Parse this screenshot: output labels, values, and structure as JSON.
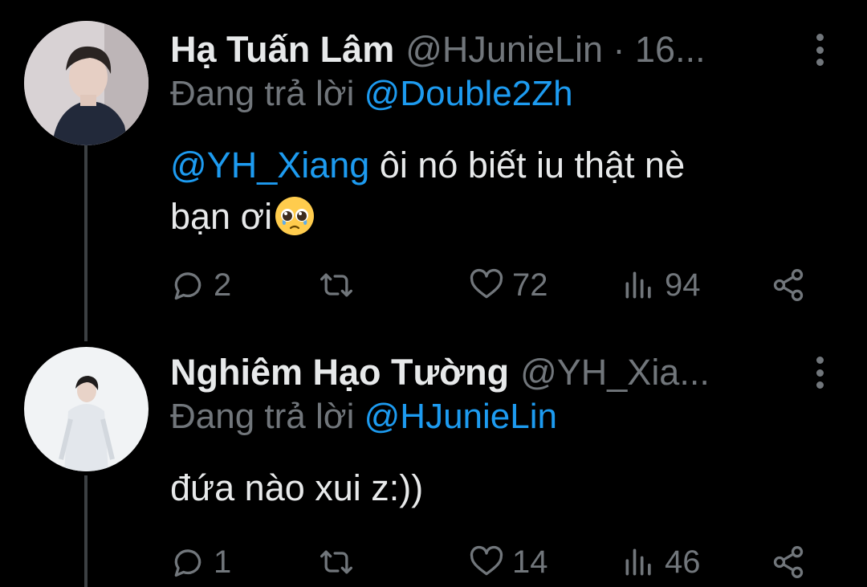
{
  "tweets": [
    {
      "name": "Hạ Tuấn Lâm",
      "handle": "@HJunieLin · 16...",
      "replying_prefix": "Đang trả lời",
      "replying_to": "@Double2Zh",
      "mention": "@YH_Xiang",
      "text_line1": " ôi nó biết iu thật nè",
      "text_line2": "bạn ơi",
      "emoji": "pleading-face",
      "replies": "2",
      "retweets": "",
      "likes": "72",
      "views": "94"
    },
    {
      "name": "Nghiêm Hạo Tường",
      "handle": "@YH_Xia...",
      "replying_prefix": "Đang trả lời",
      "replying_to": "@HJunieLin",
      "text": "đứa nào xui z:))",
      "replies": "1",
      "retweets": "",
      "likes": "14",
      "views": "46"
    }
  ],
  "colors": {
    "background": "#000000",
    "text": "#e7e9ea",
    "muted": "#71767b",
    "link": "#1d9bf0",
    "thread_line": "#3c4043"
  },
  "icons": [
    "more-vertical-icon",
    "reply-icon",
    "retweet-icon",
    "like-icon",
    "views-icon",
    "share-icon"
  ]
}
